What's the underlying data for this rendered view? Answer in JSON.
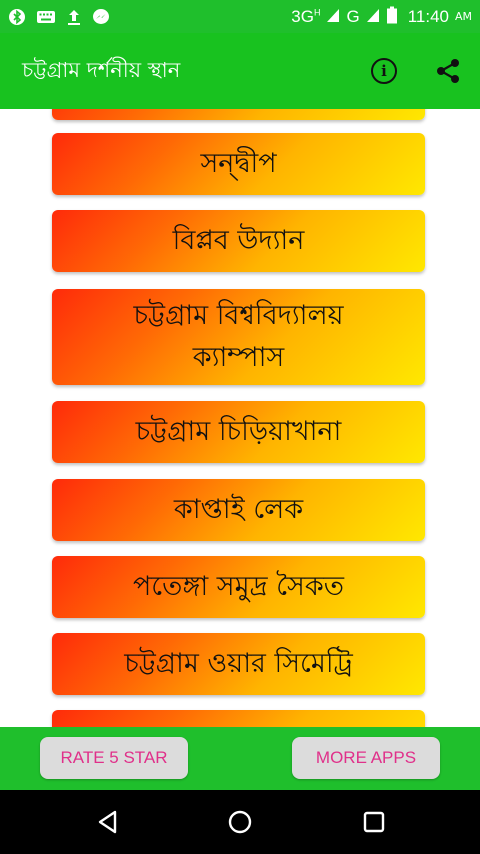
{
  "status_bar": {
    "network_3g": "3G",
    "network_h": "H",
    "network_g": "G",
    "time": "11:40",
    "ampm": "AM",
    "icons": [
      "bluetooth-icon",
      "keyboard-icon",
      "upload-icon",
      "messenger-icon",
      "signal-icon",
      "signal-icon",
      "battery-icon"
    ]
  },
  "app_bar": {
    "title": "চট্টগ্রাম দর্শনীয় স্থান",
    "info_icon": "info-icon",
    "share_icon": "share-icon"
  },
  "places": [
    {
      "label": "…"
    },
    {
      "label": "সন্দ্বীপ"
    },
    {
      "label": "বিপ্লব উদ্যান"
    },
    {
      "label": "চট্টগ্রাম বিশ্ববিদ্যালয় ক্যাম্পাস"
    },
    {
      "label": "চট্টগ্রাম চিড়িয়াখানা"
    },
    {
      "label": "কাপ্তাই লেক"
    },
    {
      "label": "পতেঙ্গা সমুদ্র সৈকত"
    },
    {
      "label": "চট্টগ্রাম ওয়ার সিমেট্রি"
    },
    {
      "label": "…"
    }
  ],
  "bottom_bar": {
    "rate_label": "RATE 5 STAR",
    "more_label": "MORE APPS"
  },
  "colors": {
    "green": "#1fbf2c",
    "button_gradient": [
      "#ff2a0a",
      "#ffb400",
      "#ffe800"
    ],
    "pill_text": "#e0308a"
  }
}
